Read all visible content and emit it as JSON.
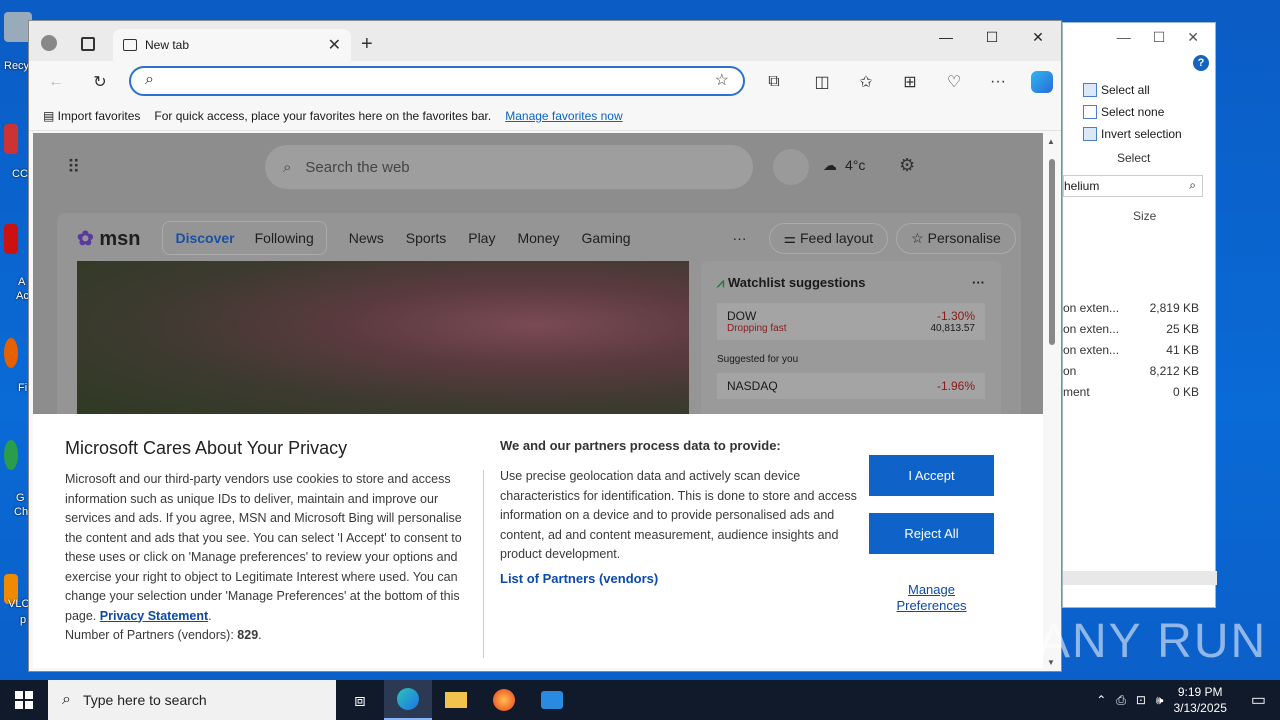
{
  "desktop": {
    "icon_labels": [
      "Recy",
      "CC",
      "A",
      "Ac",
      "Fi",
      "G",
      "Ch",
      "VLC",
      "p"
    ]
  },
  "explorer": {
    "select_all": "Select all",
    "select_none": "Select none",
    "invert_selection": "Invert selection",
    "select_group": "Select",
    "search_text": "helium",
    "size_header": "Size",
    "files": [
      {
        "type": "on exten...",
        "size": "2,819 KB"
      },
      {
        "type": "on exten...",
        "size": "25 KB"
      },
      {
        "type": "on exten...",
        "size": "41 KB"
      },
      {
        "type": "on",
        "size": "8,212 KB"
      },
      {
        "type": "ment",
        "size": "0 KB"
      }
    ]
  },
  "browser": {
    "tab_title": "New tab",
    "address_value": "",
    "favbar": {
      "import": "Import favorites",
      "message": "For quick access, place your favorites here on the favorites bar.",
      "manage_link": "Manage favorites now"
    }
  },
  "newtab": {
    "search_placeholder": "Search the web",
    "weather": "4°c",
    "msn_logo": "msn",
    "nav": [
      "Discover",
      "Following",
      "News",
      "Sports",
      "Play",
      "Money",
      "Gaming"
    ],
    "more": "···",
    "feed_layout": "Feed layout",
    "personalise": "Personalise",
    "watchlist": {
      "title": "Watchlist suggestions",
      "stock_name": "DOW",
      "stock_status": "Dropping fast",
      "stock_change": "-1.30%",
      "stock_value": "40,813.57",
      "suggested": "Suggested for you",
      "stock2_name": "NASDAQ",
      "stock2_change": "-1.96%"
    }
  },
  "privacy": {
    "title": "Microsoft Cares About Your Privacy",
    "body": "Microsoft and our third-party vendors use cookies to store and access information such as unique IDs to deliver, maintain and improve our services and ads. If you agree, MSN and Microsoft Bing will personalise the content and ads that you see. You can select 'I Accept' to consent to these uses or click on 'Manage preferences' to review your options and exercise your right to object to Legitimate Interest where used.  You can change your selection under 'Manage Preferences' at the bottom of this page.",
    "privacy_link": "Privacy Statement",
    "partners_label": "Number of Partners (vendors):",
    "partners_count": "829",
    "col2_title": "We and our partners process data to provide:",
    "col2_body": "Use precise geolocation data and actively scan device characteristics for identification. This is done to store and access information on a device and to provide personalised ads and content, ad and content measurement, audience insights and product development.",
    "partners_link": "List of Partners (vendors)",
    "accept": "I Accept",
    "reject": "Reject All",
    "manage_line1": "Manage",
    "manage_line2": "Preferences"
  },
  "watermark": "ANY RUN",
  "taskbar": {
    "search_placeholder": "Type here to search",
    "time": "9:19 PM",
    "date": "3/13/2025"
  }
}
